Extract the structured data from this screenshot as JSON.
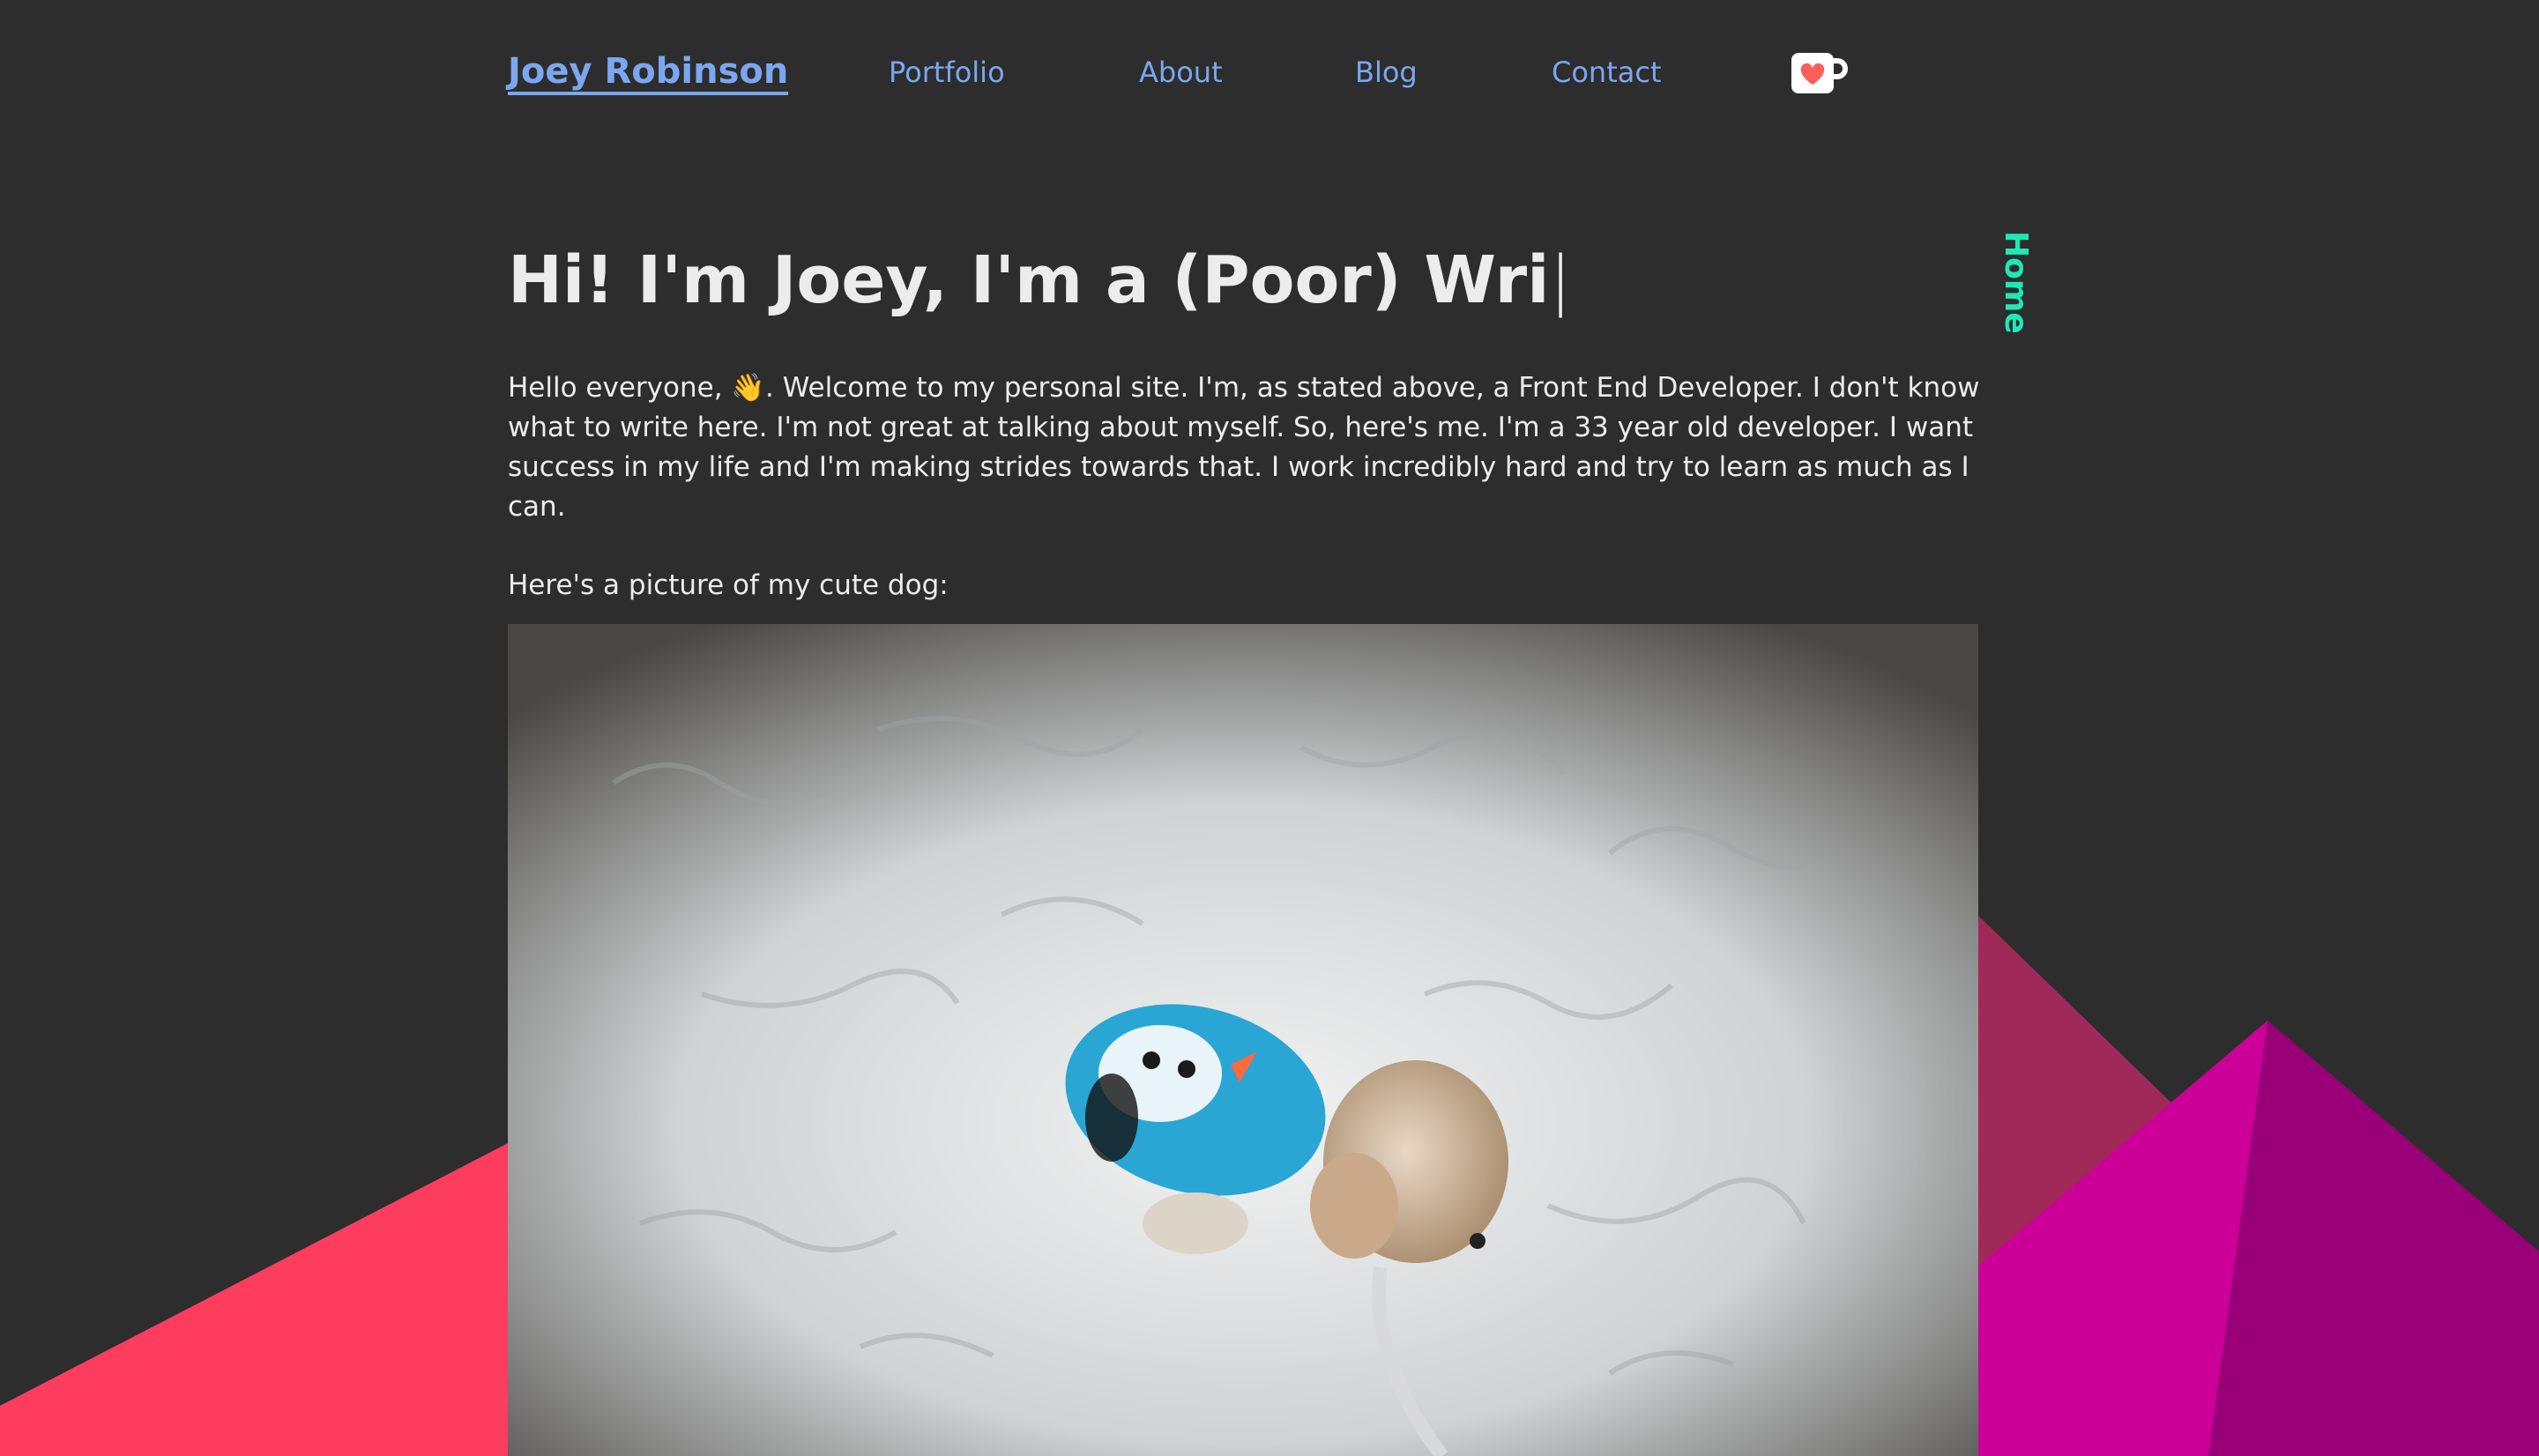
{
  "header": {
    "brand": "Joey Robinson",
    "nav": [
      {
        "label": "Portfolio"
      },
      {
        "label": "About"
      },
      {
        "label": "Blog"
      },
      {
        "label": "Contact"
      }
    ],
    "kofi_icon": "kofi-cup-icon",
    "theme_toggle_icon": "moon-icon"
  },
  "side_label": "Home",
  "main": {
    "title": "Hi! I'm Joey, I'm a (Poor) Wri",
    "cursor": "|",
    "intro": "Hello everyone, 👋. Welcome to my personal site. I'm, as stated above, a Front End Developer. I don't know what to write here. I'm not great at talking about myself. So, here's me. I'm a 33 year old developer. I want success in my life and I'm making strides towards that. I work incredibly hard and try to learn as much as I can.",
    "dog_caption": "Here's a picture of my cute dog:"
  },
  "colors": {
    "background": "#2d2d2d",
    "link": "#7aa7f0",
    "accent_side": "#1de9b6",
    "text": "#ececec",
    "mountain_red": "#fd3c5e",
    "mountain_magenta": "#cc0099",
    "mountain_maroon": "#9f2a58",
    "mountain_purple": "#990077"
  }
}
